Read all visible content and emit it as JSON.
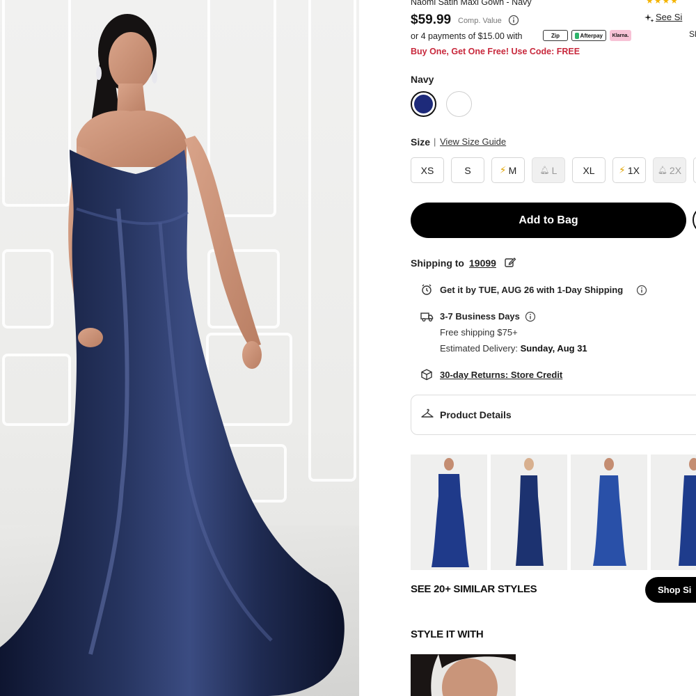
{
  "product": {
    "title": "Naomi Satin Maxi Gown - Navy",
    "rating_stars": "★★★★",
    "price": "$59.99",
    "comp_value_label": "Comp. Value",
    "see_size_link": "See Si",
    "ship_partial": "Sl",
    "payments_text": "or 4 payments of $15.00 with",
    "payment_badges": {
      "zip": "Zip",
      "afterpay": "Afterpay",
      "klarna": "Klarna."
    },
    "promo": "Buy One, Get One Free! Use Code: FREE"
  },
  "color": {
    "label": "Navy",
    "swatches": [
      {
        "name": "Navy",
        "hex": "#1d2a7a",
        "selected": true
      },
      {
        "name": "White",
        "hex": "#ffffff",
        "selected": false
      }
    ]
  },
  "size": {
    "label": "Size",
    "separator": "|",
    "guide_link": "View Size Guide",
    "options": [
      {
        "label": "XS",
        "state": "available"
      },
      {
        "label": "S",
        "state": "available"
      },
      {
        "label": "M",
        "state": "low-stock"
      },
      {
        "label": "L",
        "state": "out-of-stock"
      },
      {
        "label": "XL",
        "state": "available"
      },
      {
        "label": "1X",
        "state": "low-stock"
      },
      {
        "label": "2X",
        "state": "out-of-stock"
      }
    ]
  },
  "cart": {
    "add_to_bag": "Add to Bag"
  },
  "shipping": {
    "label": "Shipping to",
    "zip": "19099",
    "delivery_line_prefix": "Get it by ",
    "delivery_date": "TUE, AUG 26",
    "delivery_suffix": " with 1-Day Shipping",
    "standard_title": "3-7 Business Days",
    "free_shipping": "Free shipping $75+",
    "estimated_label": "Estimated Delivery: ",
    "estimated_date": "Sunday, Aug 31",
    "returns": "30-day Returns: Store Credit"
  },
  "details": {
    "label": "Product Details"
  },
  "similar": {
    "heading": "SEE 20+ SIMILAR STYLES",
    "button": "Shop Si",
    "thumb_colors": [
      "#1f3a8a",
      "#1c3270",
      "#2950a8",
      "#1e3c8c"
    ]
  },
  "style_with": {
    "heading": "STYLE IT WITH"
  },
  "colors": {
    "accent": "#000000",
    "promo": "#c8283c",
    "navy": "#1d2a7a",
    "star": "#f4b400"
  }
}
